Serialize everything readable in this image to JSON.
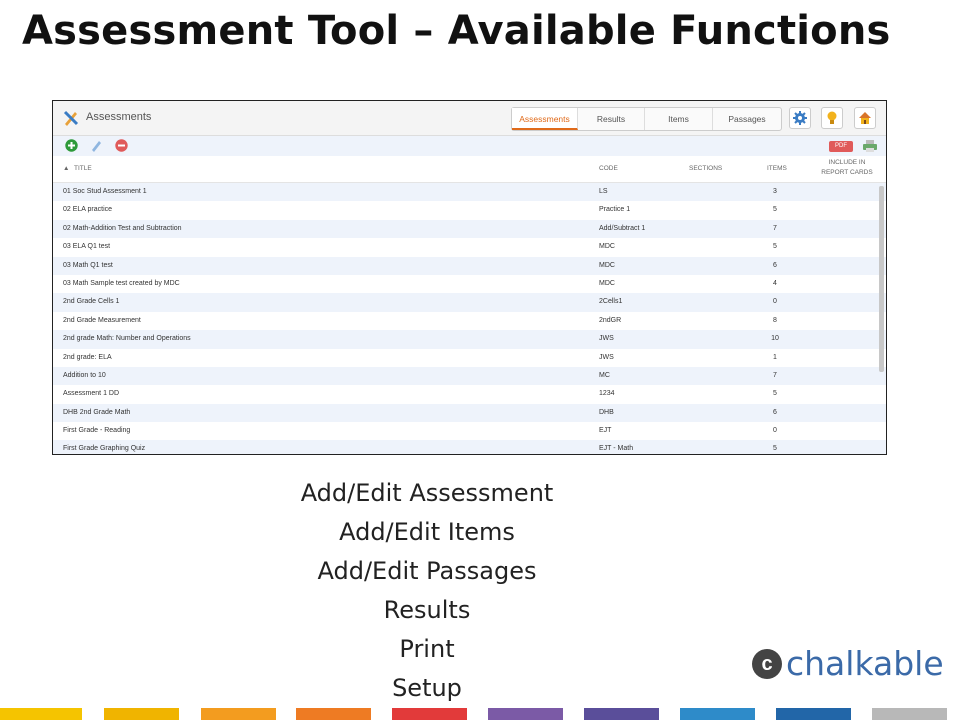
{
  "slide": {
    "title": "Assessment Tool – Available Functions"
  },
  "app": {
    "title": "Assessments",
    "tabs": [
      {
        "label": "Assessments",
        "active": true
      },
      {
        "label": "Results",
        "active": false
      },
      {
        "label": "Items",
        "active": false
      },
      {
        "label": "Passages",
        "active": false
      }
    ],
    "toolbar": {
      "pdf_label": "PDF"
    },
    "columns": {
      "title": "TITLE",
      "code": "CODE",
      "sections": "SECTIONS",
      "items": "ITEMS",
      "report_cards": "INCLUDE IN REPORT CARDS"
    },
    "rows": [
      {
        "title": "01 Soc Stud Assessment 1",
        "code": "LS",
        "items": "3"
      },
      {
        "title": "02 ELA practice",
        "code": "Practice 1",
        "items": "5"
      },
      {
        "title": "02 Math-Addition Test and Subtraction",
        "code": "Add/Subtract 1",
        "items": "7"
      },
      {
        "title": "03 ELA Q1 test",
        "code": "MDC",
        "items": "5"
      },
      {
        "title": "03 Math Q1 test",
        "code": "MDC",
        "items": "6"
      },
      {
        "title": "03 Math Sample test created by MDC",
        "code": "MDC",
        "items": "4"
      },
      {
        "title": "2nd Grade Cells 1",
        "code": "2Cells1",
        "items": "0"
      },
      {
        "title": "2nd Grade Measurement",
        "code": "2ndGR",
        "items": "8"
      },
      {
        "title": "2nd grade Math: Number and Operations",
        "code": "JWS",
        "items": "10"
      },
      {
        "title": "2nd grade: ELA",
        "code": "JWS",
        "items": "1"
      },
      {
        "title": "Addition to 10",
        "code": "MC",
        "items": "7"
      },
      {
        "title": "Assessment 1 DD",
        "code": "1234",
        "items": "5"
      },
      {
        "title": "DHB 2nd Grade Math",
        "code": "DHB",
        "items": "6"
      },
      {
        "title": "First Grade - Reading",
        "code": "EJT",
        "items": "0"
      },
      {
        "title": "First Grade Graphing Quiz",
        "code": "EJT - Math",
        "items": "5"
      }
    ]
  },
  "functions": [
    "Add/Edit Assessment",
    "Add/Edit Items",
    "Add/Edit Passages",
    "Results",
    "Print",
    "Setup"
  ],
  "brand": {
    "mark": "c",
    "name": "chalkable"
  },
  "bottom_bar_colors": [
    "#f5c400",
    "#f0b400",
    "#f39c1f",
    "#ee7b23",
    "#e23a3a",
    "#7b5aa6",
    "#5a4e9a",
    "#2e8bc9",
    "#2266a8",
    "#b8b8b8"
  ]
}
